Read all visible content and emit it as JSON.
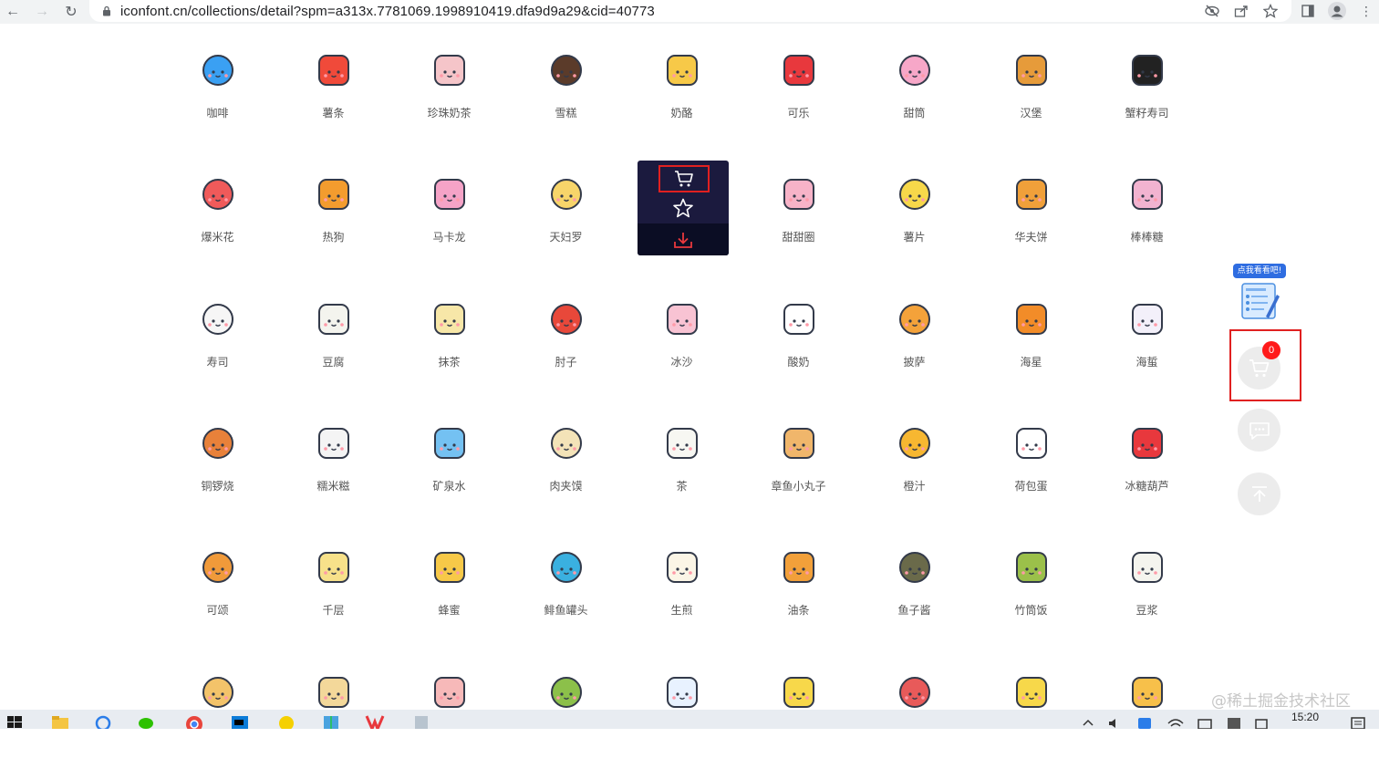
{
  "browser": {
    "url": "iconfont.cn/collections/detail?spm=a313x.7781069.1998910419.dfa9d9a29&cid=40773"
  },
  "icons": [
    {
      "label": "咖啡",
      "color": "#3aa0f3"
    },
    {
      "label": "薯条",
      "color": "#f04a3a"
    },
    {
      "label": "珍珠奶茶",
      "color": "#f5c5c9"
    },
    {
      "label": "雪糕",
      "color": "#5b3b2a"
    },
    {
      "label": "奶酪",
      "color": "#f7c948"
    },
    {
      "label": "可乐",
      "color": "#e8383d"
    },
    {
      "label": "甜筒",
      "color": "#f7a7c8"
    },
    {
      "label": "汉堡",
      "color": "#e69b3a"
    },
    {
      "label": "蟹籽寿司",
      "color": "#222222"
    },
    {
      "label": "爆米花",
      "color": "#f05a5a"
    },
    {
      "label": "热狗",
      "color": "#f39c2e"
    },
    {
      "label": "马卡龙",
      "color": "#f5a3c7"
    },
    {
      "label": "天妇罗",
      "color": "#f7d56a"
    },
    {
      "label": "",
      "color": "#f5c48a"
    },
    {
      "label": "甜甜圈",
      "color": "#f7b3c8"
    },
    {
      "label": "薯片",
      "color": "#f7d84a"
    },
    {
      "label": "华夫饼",
      "color": "#f0a03a"
    },
    {
      "label": "棒棒糖",
      "color": "#f2b3d0"
    },
    {
      "label": "寿司",
      "color": "#f6f6f6"
    },
    {
      "label": "豆腐",
      "color": "#f4f4ee"
    },
    {
      "label": "抹茶",
      "color": "#f7e7a8"
    },
    {
      "label": "肘子",
      "color": "#e8483a"
    },
    {
      "label": "冰沙",
      "color": "#f8c3d3"
    },
    {
      "label": "酸奶",
      "color": "#ffffff"
    },
    {
      "label": "披萨",
      "color": "#f4a23a"
    },
    {
      "label": "海星",
      "color": "#f28c28"
    },
    {
      "label": "海蜇",
      "color": "#f3f0fa"
    },
    {
      "label": "铜锣烧",
      "color": "#e8813a"
    },
    {
      "label": "糯米糍",
      "color": "#f4f4f4"
    },
    {
      "label": "矿泉水",
      "color": "#74c1f2"
    },
    {
      "label": "肉夹馍",
      "color": "#f3e3b8"
    },
    {
      "label": "茶",
      "color": "#f7f7f2"
    },
    {
      "label": "章鱼小丸子",
      "color": "#f0b66b"
    },
    {
      "label": "橙汁",
      "color": "#f7b731"
    },
    {
      "label": "荷包蛋",
      "color": "#ffffff"
    },
    {
      "label": "冰糖葫芦",
      "color": "#e8383d"
    },
    {
      "label": "可颂",
      "color": "#f09a3a"
    },
    {
      "label": "千层",
      "color": "#f7e18a"
    },
    {
      "label": "蜂蜜",
      "color": "#f7c948"
    },
    {
      "label": "鲱鱼罐头",
      "color": "#3ab0e0"
    },
    {
      "label": "生煎",
      "color": "#fbf5e6"
    },
    {
      "label": "油条",
      "color": "#f2a03a"
    },
    {
      "label": "鱼子酱",
      "color": "#6a6a4a"
    },
    {
      "label": "竹筒饭",
      "color": "#9bc04a"
    },
    {
      "label": "豆浆",
      "color": "#f4f4ee"
    },
    {
      "label": "",
      "color": "#f3c36a"
    },
    {
      "label": "",
      "color": "#f3d89a"
    },
    {
      "label": "",
      "color": "#f7b9b9"
    },
    {
      "label": "",
      "color": "#8cc04a"
    },
    {
      "label": "",
      "color": "#e8f2ff"
    },
    {
      "label": "",
      "color": "#f7d84a"
    },
    {
      "label": "",
      "color": "#e85a5a"
    },
    {
      "label": "",
      "color": "#f7d84a"
    },
    {
      "label": "",
      "color": "#f7c04a"
    }
  ],
  "hover_panel": {
    "actions": [
      "cart-icon",
      "star-icon",
      "download-icon"
    ]
  },
  "float_widgets": {
    "tip_text": "点我看看吧!",
    "cart_count": "0"
  },
  "watermark": "@稀土掘金技术社区",
  "taskbar": {
    "time": "15:20"
  },
  "colors": {
    "highlight_red": "#e02020",
    "panel_dark": "#1b1a3e",
    "badge_red": "#ff1a1a",
    "tip_blue": "#2f6de1"
  }
}
